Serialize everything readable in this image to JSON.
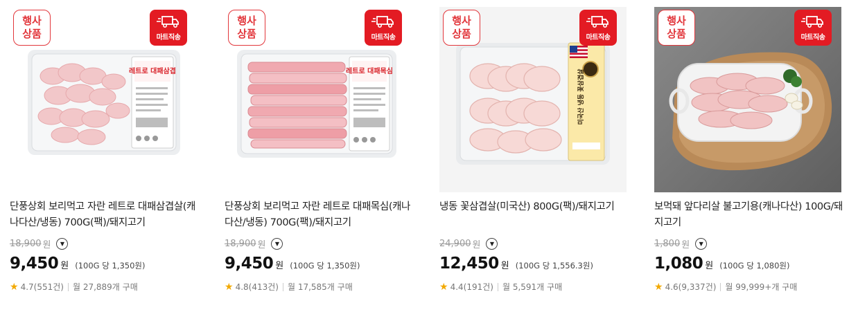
{
  "products": [
    {
      "event_badge": [
        "행사",
        "상품"
      ],
      "ship_badge": "마트직송",
      "title": "단풍상회 보리먹고 자란 레트로 대패삼겹살(캐나다산/냉동) 700G(팩)/돼지고기",
      "original_price": "18,900",
      "price": "9,450",
      "currency": "원",
      "unit_price": "(100G 당 1,350원)",
      "rating": "4.7",
      "reviews": "(551건)",
      "monthly": "월 27,889개 구매",
      "package_label": "레트로 대패삼겹",
      "package_brand": "단풍상회"
    },
    {
      "event_badge": [
        "행사",
        "상품"
      ],
      "ship_badge": "마트직송",
      "title": "단풍상회 보리먹고 자란 레트로 대패목심(캐나다산/냉동) 700G(팩)/돼지고기",
      "original_price": "18,900",
      "price": "9,450",
      "currency": "원",
      "unit_price": "(100G 당 1,350원)",
      "rating": "4.8",
      "reviews": "(413건)",
      "monthly": "월 17,585개 구매",
      "package_label": "레트로 대패목심",
      "package_brand": "단풍상회"
    },
    {
      "event_badge": [
        "행사",
        "상품"
      ],
      "ship_badge": "마트직송",
      "title": "냉동 꽃삼겹살(미국산) 800G(팩)/돼지고기",
      "original_price": "24,900",
      "price": "12,450",
      "currency": "원",
      "unit_price": "(100G 당 1,556.3원)",
      "rating": "4.4",
      "reviews": "(191건)",
      "monthly": "월 5,591개 구매",
      "package_label": "미국산 냉동 꽃삼겹살"
    },
    {
      "event_badge": [
        "행사",
        "상품"
      ],
      "ship_badge": "마트직송",
      "title": "보먹돼 앞다리살 불고기용(캐나다산) 100G/돼지고기",
      "original_price": "1,800",
      "price": "1,080",
      "currency": "원",
      "unit_price": "(100G 당 1,080원)",
      "rating": "4.6",
      "reviews": "(9,337건)",
      "monthly": "월 99,999+개 구매"
    }
  ],
  "icons": {
    "ship": "delivery-truck-icon",
    "info": "chevron-down-circle-icon",
    "star": "star-icon"
  },
  "colors": {
    "accent": "#e31b23",
    "star": "#f2a900"
  }
}
